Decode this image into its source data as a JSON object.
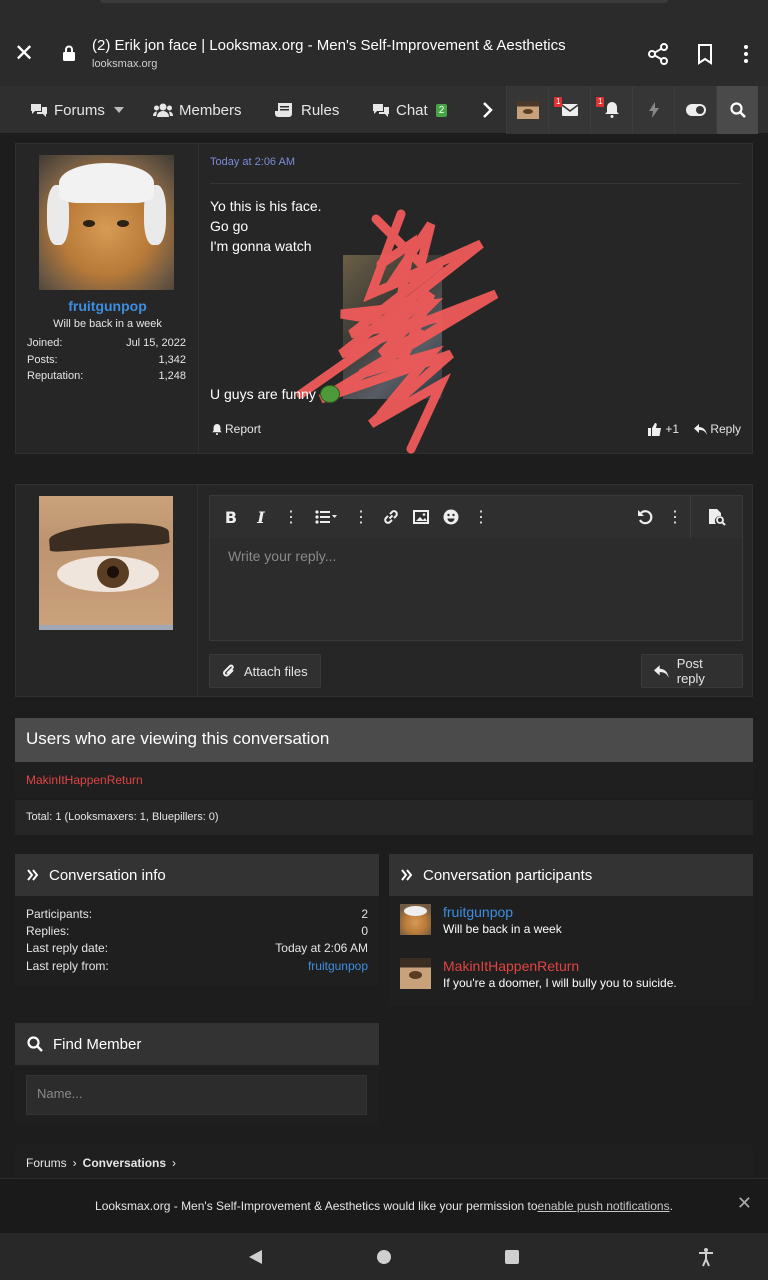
{
  "browser": {
    "title": "(2) Erik jon face | Looksmax.org - Men's Self-Improvement & Aesthetics",
    "url": "looksmax.org"
  },
  "nav": {
    "forums": "Forums",
    "members": "Members",
    "rules": "Rules",
    "chat": "Chat",
    "chat_badge": "2",
    "inbox_badge": "1",
    "alerts_badge": "1"
  },
  "message": {
    "username": "fruitgunpop",
    "user_title": "Will be back in a week",
    "stats": [
      {
        "label": "Joined:",
        "value": "Jul 15, 2022"
      },
      {
        "label": "Posts:",
        "value": "1,342"
      },
      {
        "label": "Reputation:",
        "value": "1,248"
      }
    ],
    "time": "Today at 2:06 AM",
    "lines": [
      "Yo this is his face.",
      "Go go",
      "I'm gonna watch"
    ],
    "last_line": "U guys are funny",
    "report": "Report",
    "like": "+1",
    "reply": "Reply"
  },
  "editor": {
    "placeholder": "Write your reply...",
    "attach": "Attach files",
    "post": "Post reply"
  },
  "viewers": {
    "heading": "Users who are viewing this conversation",
    "user": "MakinItHappenReturn",
    "total": "Total: 1 (Looksmaxers: 1, Bluepillers: 0)"
  },
  "conv_info": {
    "heading": "Conversation info",
    "rows": [
      {
        "label": "Participants:",
        "value": "2"
      },
      {
        "label": "Replies:",
        "value": "0"
      },
      {
        "label": "Last reply date:",
        "value": "Today at 2:06 AM"
      },
      {
        "label": "Last reply from:",
        "value": "fruitgunpop"
      }
    ]
  },
  "participants": {
    "heading": "Conversation participants",
    "items": [
      {
        "name": "fruitgunpop",
        "title": "Will be back in a week",
        "color": "#3d8ee0"
      },
      {
        "name": "MakinItHappenReturn",
        "title": "If you're a doomer, I will bully you to suicide.",
        "color": "#e04444"
      }
    ]
  },
  "find_member": {
    "heading": "Find Member",
    "placeholder": "Name..."
  },
  "breadcrumb": {
    "forums": "Forums",
    "conversations": "Conversations"
  },
  "push": {
    "text": "Looksmax.org - Men's Self-Improvement & Aesthetics would like your permission to ",
    "link": "enable push notifications",
    "end": "."
  },
  "colors": {
    "link_blue": "#3d8ee0",
    "link_red": "#e04444",
    "scribble": "#f05a5a"
  }
}
